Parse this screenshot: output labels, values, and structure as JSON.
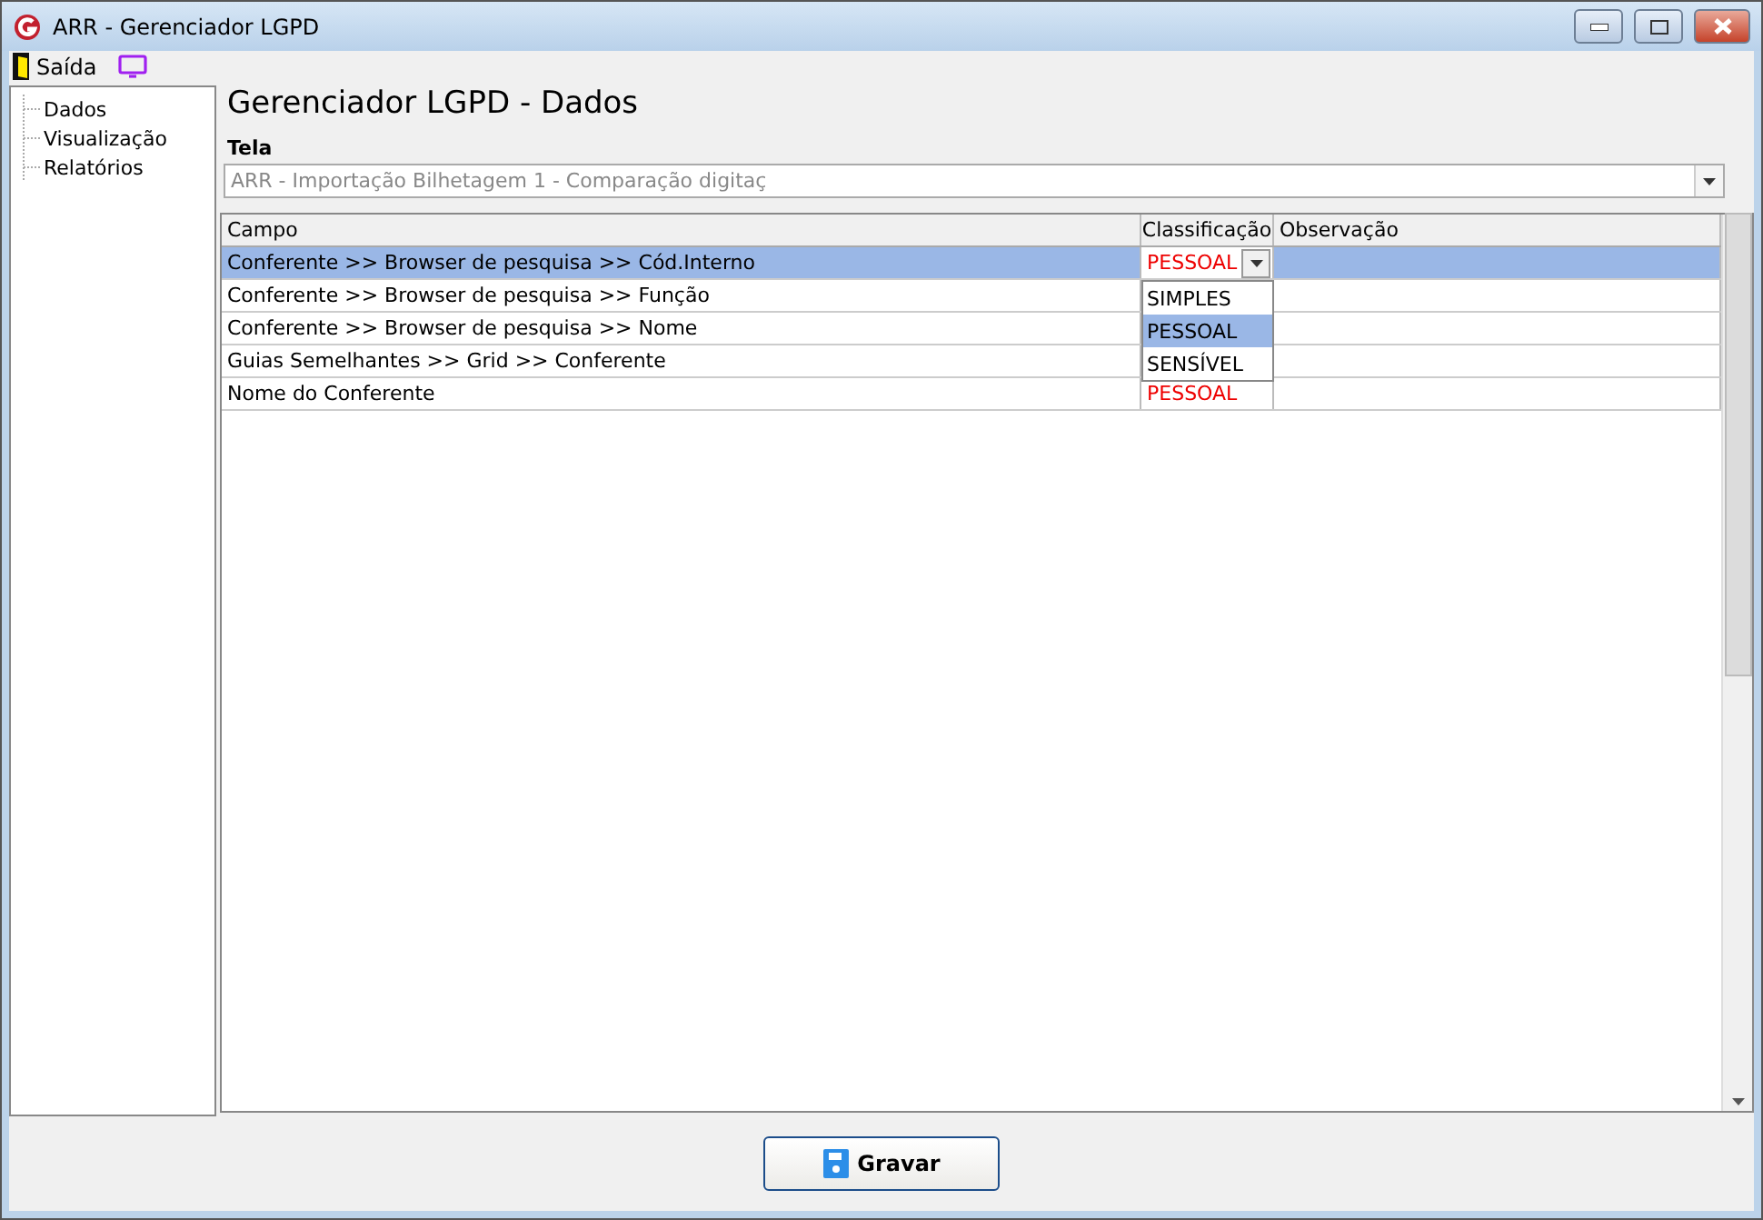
{
  "window": {
    "title": "ARR - Gerenciador LGPD"
  },
  "menu": [
    {
      "label": "Saída"
    }
  ],
  "sidebar": {
    "items": [
      {
        "label": "Dados"
      },
      {
        "label": "Visualização"
      },
      {
        "label": "Relatórios"
      }
    ]
  },
  "heading": "Gerenciador LGPD - Dados",
  "tela": {
    "label": "Tela",
    "value": "ARR - Importação Bilhetagem 1 - Comparação digitaç",
    "disabled": true
  },
  "table": {
    "columns": [
      "Campo",
      "Classificação",
      "Observação"
    ],
    "rows": [
      {
        "campo": "Conferente >> Browser de pesquisa >> Cód.Interno",
        "classificacao": "PESSOAL",
        "selected": true
      },
      {
        "campo": "Conferente >> Browser de pesquisa >> Função",
        "selected": false
      },
      {
        "campo": "Conferente >> Browser de pesquisa >> Nome",
        "selected": false
      },
      {
        "campo": "Guias Semelhantes >> Grid >> Conferente",
        "selected": false
      },
      {
        "campo": "Nome do Conferente",
        "classificacao": "PESSOAL",
        "selected": false
      }
    ],
    "dropdown": {
      "options": [
        {
          "label": "SIMPLES",
          "selected": false
        },
        {
          "label": "PESSOAL",
          "selected": true
        },
        {
          "label": "SENSÍVEL",
          "selected": false
        }
      ]
    }
  },
  "buttons": [
    {
      "label": "Gravar"
    }
  ]
}
